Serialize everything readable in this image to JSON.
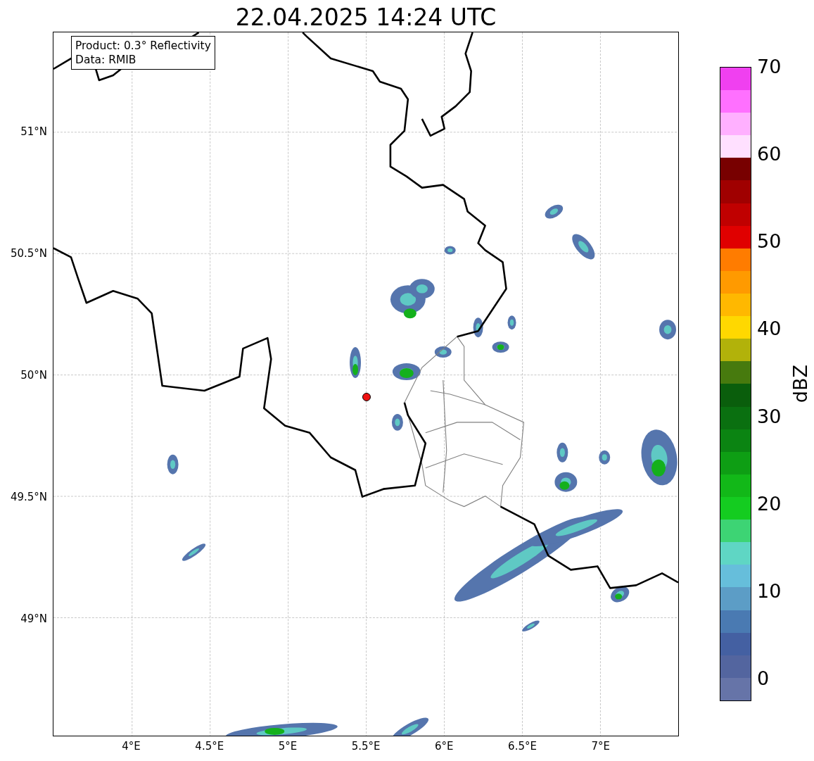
{
  "title": "22.04.2025 14:24 UTC",
  "info_box": [
    "Product: 0.3° Reflectivity",
    "Data: RMIB"
  ],
  "map": {
    "yticks": [
      "51°N",
      "50.5°N",
      "50°N",
      "49.5°N",
      "49°N"
    ],
    "xticks": [
      "4°E",
      "4.5°E",
      "5°E",
      "5.5°E",
      "6°E",
      "6.5°E",
      "7°E"
    ]
  },
  "colorbar": {
    "label": "dBZ",
    "ticks": [
      "70",
      "60",
      "50",
      "40",
      "30",
      "20",
      "10",
      "0"
    ],
    "bands": [
      {
        "color": "#6674a8"
      },
      {
        "color": "#53659f"
      },
      {
        "color": "#4460a2"
      },
      {
        "color": "#4a7ab2"
      },
      {
        "color": "#5c9dc6"
      },
      {
        "color": "#66bedb"
      },
      {
        "color": "#5fd6c4"
      },
      {
        "color": "#3dd474"
      },
      {
        "color": "#14cc20"
      },
      {
        "color": "#12b818"
      },
      {
        "color": "#0e9e14"
      },
      {
        "color": "#0b8412"
      },
      {
        "color": "#0a7010"
      },
      {
        "color": "#0a5e0c"
      },
      {
        "color": "#477a0e"
      },
      {
        "color": "#b2b20a"
      },
      {
        "color": "#ffd800"
      },
      {
        "color": "#ffb800"
      },
      {
        "color": "#ff9a00"
      },
      {
        "color": "#ff7c00"
      },
      {
        "color": "#e00000"
      },
      {
        "color": "#c00000"
      },
      {
        "color": "#a00000"
      },
      {
        "color": "#780000"
      },
      {
        "color": "#ffe0ff"
      },
      {
        "color": "#ffb0ff"
      },
      {
        "color": "#ff70ff"
      },
      {
        "color": "#f040f0"
      }
    ]
  }
}
